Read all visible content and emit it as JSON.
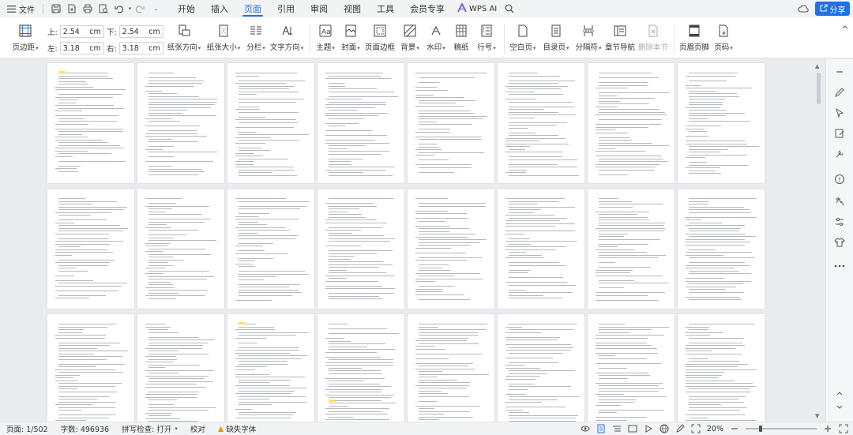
{
  "menubar": {
    "file_label": "文件",
    "tabs": [
      {
        "label": "开始",
        "active": false
      },
      {
        "label": "插入",
        "active": false
      },
      {
        "label": "页面",
        "active": true
      },
      {
        "label": "引用",
        "active": false
      },
      {
        "label": "审阅",
        "active": false
      },
      {
        "label": "视图",
        "active": false
      },
      {
        "label": "工具",
        "active": false
      },
      {
        "label": "会员专享",
        "active": false
      }
    ],
    "wps_ai_label": "WPS AI",
    "share_label": "分享"
  },
  "ribbon": {
    "margins_label": "页边距",
    "margin_top_label": "上:",
    "margin_top_value": "2.54",
    "margin_bottom_label": "下:",
    "margin_bottom_value": "2.54",
    "margin_left_label": "左:",
    "margin_left_value": "3.18",
    "margin_right_label": "右:",
    "margin_right_value": "3.18",
    "unit": "cm",
    "orientation_label": "纸张方向",
    "size_label": "纸张大小",
    "columns_label": "分栏",
    "text_direction_label": "文字方向",
    "theme_label": "主题",
    "cover_label": "封面",
    "page_border_label": "页面边框",
    "background_label": "背景",
    "watermark_label": "水印",
    "manuscript_label": "稿纸",
    "line_number_label": "行号",
    "blank_page_label": "空白页",
    "toc_page_label": "目录页",
    "break_label": "分隔符",
    "section_nav_label": "章节导航",
    "delete_section_label": "删除本节",
    "header_footer_label": "页眉页脚",
    "page_number_label": "页码"
  },
  "status": {
    "page_label": "页面: 1/502",
    "word_count_label": "字数: 496936",
    "spell_check_label": "拼写检查: 打开",
    "proofread_label": "校对",
    "missing_font_label": "缺失字体",
    "zoom_label": "20%",
    "zoom_fraction": 0.2
  },
  "colors": {
    "accent": "#1f6fe5",
    "highlight": "#ffe14d",
    "warning": "#e59400"
  }
}
